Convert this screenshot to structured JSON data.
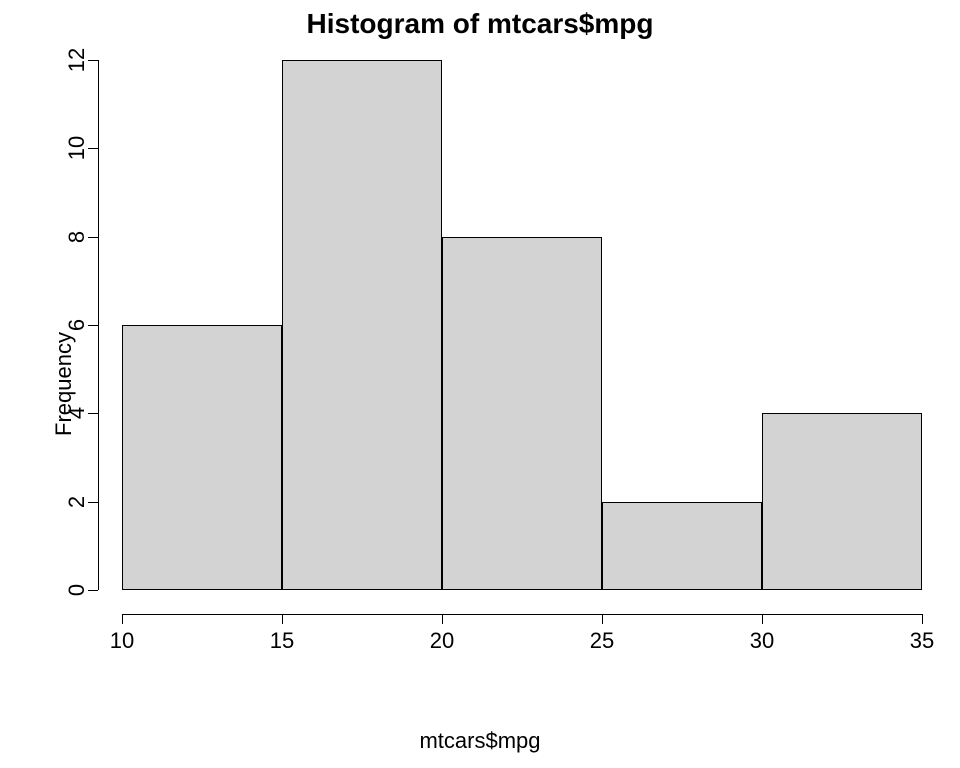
{
  "chart_data": {
    "type": "bar",
    "title": "Histogram of mtcars$mpg",
    "xlabel": "mtcars$mpg",
    "ylabel": "Frequency",
    "categories": [
      "10-15",
      "15-20",
      "20-25",
      "25-30",
      "30-35"
    ],
    "bin_edges": [
      10,
      15,
      20,
      25,
      30,
      35
    ],
    "values": [
      6,
      12,
      8,
      2,
      4
    ],
    "xlim": [
      10,
      35
    ],
    "ylim": [
      0,
      12
    ],
    "x_ticks": [
      10,
      15,
      20,
      25,
      30,
      35
    ],
    "y_ticks": [
      0,
      2,
      4,
      6,
      8,
      10,
      12
    ],
    "bar_fill": "#d3d3d3",
    "bar_stroke": "#000000"
  }
}
